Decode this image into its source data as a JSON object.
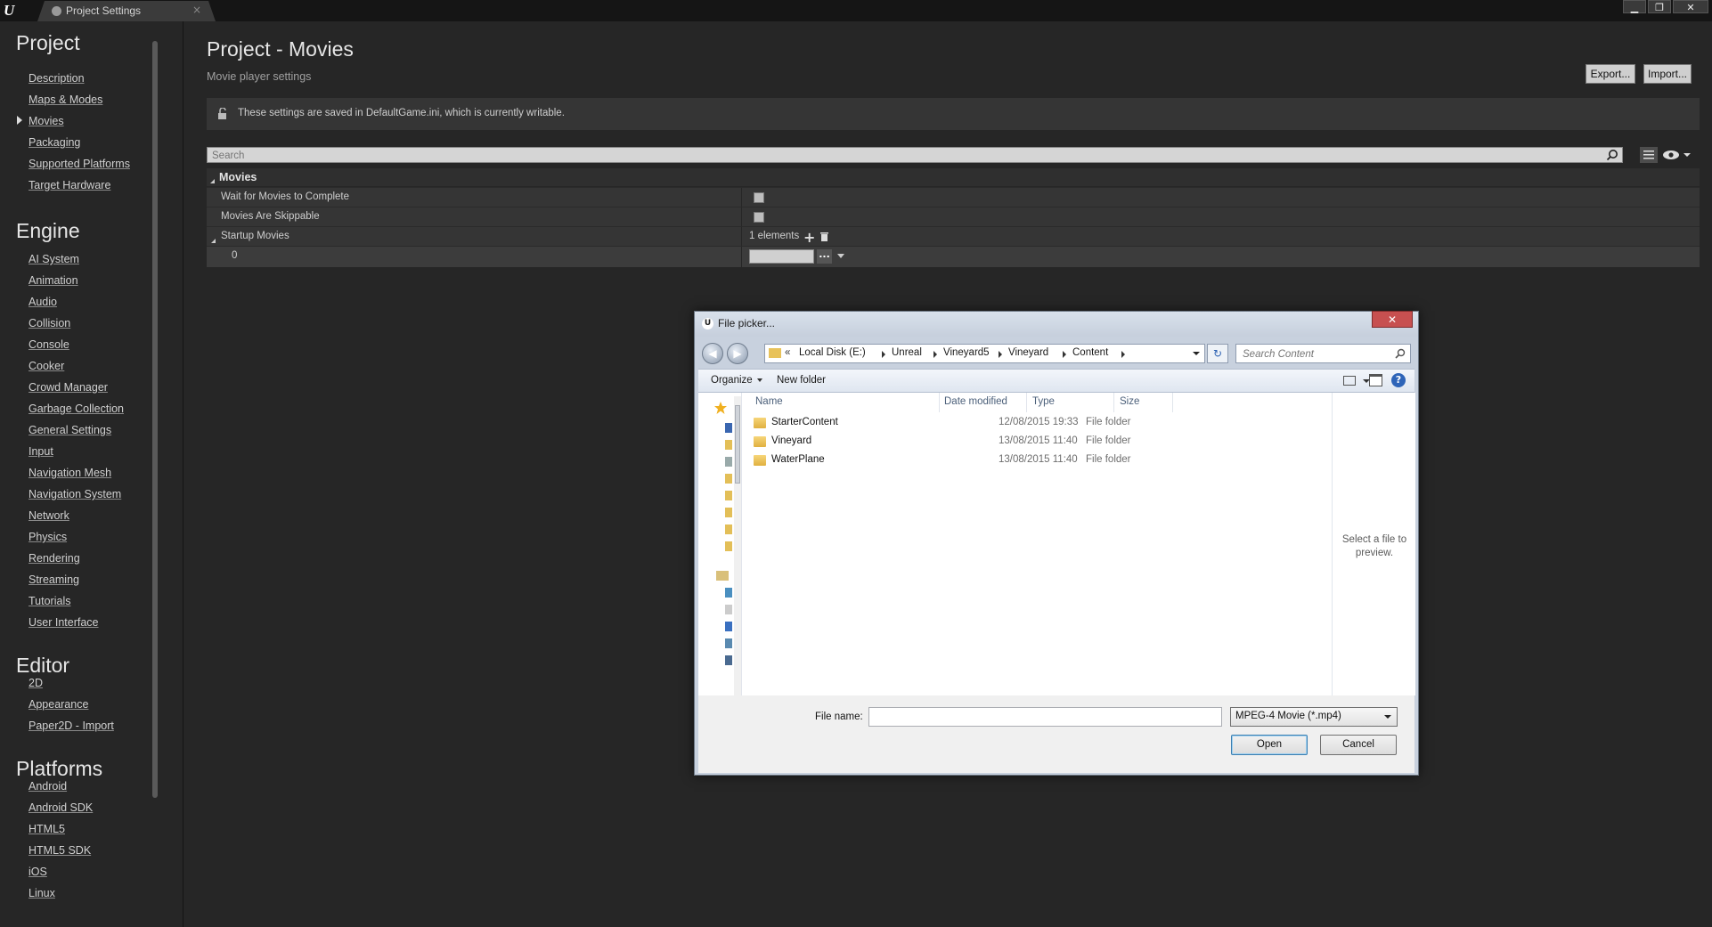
{
  "window": {
    "tab_label": "Project Settings",
    "tab_close": "×",
    "minimize": "▁",
    "restore": "❐",
    "close": "✕"
  },
  "sidebar": {
    "sections": [
      {
        "title": "Project",
        "items": [
          "Description",
          "Maps & Modes",
          "Movies",
          "Packaging",
          "Supported Platforms",
          "Target Hardware"
        ]
      },
      {
        "title": "Engine",
        "items": [
          "AI System",
          "Animation",
          "Audio",
          "Collision",
          "Console",
          "Cooker",
          "Crowd Manager",
          "Garbage Collection",
          "General Settings",
          "Input",
          "Navigation Mesh",
          "Navigation System",
          "Network",
          "Physics",
          "Rendering",
          "Streaming",
          "Tutorials",
          "User Interface"
        ]
      },
      {
        "title": "Editor",
        "items": [
          "2D",
          "Appearance",
          "Paper2D - Import"
        ]
      },
      {
        "title": "Platforms",
        "items": [
          "Android",
          "Android SDK",
          "HTML5",
          "HTML5 SDK",
          "iOS",
          "Linux"
        ]
      }
    ],
    "active_item": "Movies"
  },
  "main": {
    "title": "Project - Movies",
    "subtitle": "Movie player settings",
    "export_label": "Export...",
    "import_label": "Import...",
    "info_text": "These settings are saved in DefaultGame.ini, which is currently writable.",
    "search_placeholder": "Search",
    "category": "Movies",
    "properties": {
      "wait_label": "Wait for Movies to Complete",
      "skippable_label": "Movies Are Skippable",
      "startup_label": "Startup Movies",
      "elements_count": "1 elements",
      "index_label": "0",
      "dots_label": "..."
    }
  },
  "dialog": {
    "title": "File picker...",
    "close_label": "✕",
    "back_glyph": "◀",
    "forward_glyph": "▶",
    "refresh_glyph": "↻",
    "crumb_prefix": "«",
    "breadcrumb": [
      "Local Disk (E:)",
      "Unreal",
      "Vineyard5",
      "Vineyard",
      "Content"
    ],
    "search_placeholder": "Search Content",
    "organize_label": "Organize",
    "new_folder_label": "New folder",
    "help_label": "?",
    "columns": {
      "name": "Name",
      "date": "Date modified",
      "type": "Type",
      "size": "Size"
    },
    "files": [
      {
        "name": "StarterContent",
        "date": "12/08/2015 19:33",
        "type": "File folder"
      },
      {
        "name": "Vineyard",
        "date": "13/08/2015 11:40",
        "type": "File folder"
      },
      {
        "name": "WaterPlane",
        "date": "13/08/2015 11:40",
        "type": "File folder"
      }
    ],
    "preview_text": "Select a file to preview.",
    "file_name_label": "File name:",
    "file_name_value": "",
    "file_type": "MPEG-4 Movie (*.mp4)",
    "open_label": "Open",
    "cancel_label": "Cancel"
  }
}
